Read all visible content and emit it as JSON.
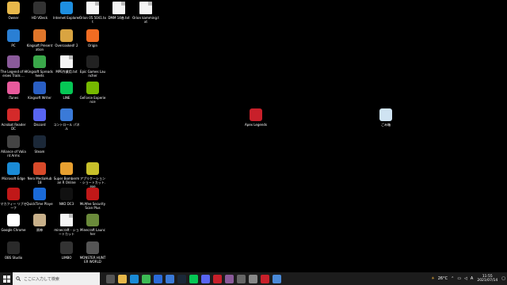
{
  "desktop_icons": [
    {
      "label": "Owner",
      "icon": "user-folder-icon",
      "color": "#e8b84a"
    },
    {
      "label": "HD VDeck",
      "icon": "hd-vdeck-icon",
      "color": "#333333"
    },
    {
      "label": "Internet Explorer",
      "icon": "internet-explorer-icon",
      "color": "#1e8fe0"
    },
    {
      "label": "Orion 05.5041.txt",
      "icon": "text-file-icon",
      "color": "#f4f4f4"
    },
    {
      "label": "DMM 14巻.txt",
      "icon": "text-file-icon",
      "color": "#f4f4f4"
    },
    {
      "label": "Orion kamming.txt",
      "icon": "text-file-icon",
      "color": "#f4f4f4"
    },
    {
      "label": "PC",
      "icon": "pc-icon",
      "color": "#2a7fd4"
    },
    {
      "label": "Kingsoft Presentation",
      "icon": "kingsoft-presentation-icon",
      "color": "#e0762a"
    },
    {
      "label": "Overcooked! 2",
      "icon": "overcooked-icon",
      "color": "#d9a441"
    },
    {
      "label": "Origin",
      "icon": "origin-icon",
      "color": "#f26c22"
    },
    {
      "label": "The Legend of Heroes Trails ...",
      "icon": "game-icon",
      "color": "#8a5a9a"
    },
    {
      "label": "Kingsoft Spreadsheets",
      "icon": "kingsoft-spreadsheets-icon",
      "color": "#3aa84a"
    },
    {
      "label": "MPE作業用.txt",
      "icon": "text-file-icon",
      "color": "#f4f4f4"
    },
    {
      "label": "Epic Games Launcher",
      "icon": "epic-games-icon",
      "color": "#222222"
    },
    {
      "label": "iTunes",
      "icon": "itunes-icon",
      "color": "#e85a9c"
    },
    {
      "label": "Kingsoft Writer",
      "icon": "kingsoft-writer-icon",
      "color": "#2a5fc4"
    },
    {
      "label": "LINE",
      "icon": "line-icon",
      "color": "#06c755"
    },
    {
      "label": "GeForce Experience",
      "icon": "geforce-icon",
      "color": "#76b900"
    },
    {
      "label": "Acrobat Reader DC",
      "icon": "acrobat-icon",
      "color": "#d42a2a"
    },
    {
      "label": "Discord",
      "icon": "discord-icon",
      "color": "#5865f2"
    },
    {
      "label": "コントロール パネル",
      "icon": "control-panel-icon",
      "color": "#3a7ad8"
    },
    {
      "label": "Apex Legends",
      "icon": "apex-legends-icon",
      "color": "#c8202a"
    },
    {
      "label": "ごみ箱",
      "icon": "recycle-bin-icon",
      "color": "#cfe3f2"
    },
    {
      "label": "Alliance of Valiant Arms",
      "icon": "ava-icon",
      "color": "#444444"
    },
    {
      "label": "Steam",
      "icon": "steam-icon",
      "color": "#1b2838"
    },
    {
      "label": "Microsoft Edge",
      "icon": "edge-icon",
      "color": "#1a8bd6"
    },
    {
      "label": "Nero MediaHub 18",
      "icon": "nero-icon",
      "color": "#d84a2a"
    },
    {
      "label": "Super Bomberman R Online",
      "icon": "bomberman-icon",
      "color": "#e8a030"
    },
    {
      "label": "アプリケーション - ショートカット.exe",
      "icon": "app-shortcut-icon",
      "color": "#c8c02a"
    },
    {
      "label": "マカフィー リブセーフ",
      "icon": "mcafee-icon",
      "color": "#c01818"
    },
    {
      "label": "QuickTime Player",
      "icon": "quicktime-icon",
      "color": "#1a6ad8"
    },
    {
      "label": "NKO DC3",
      "icon": "nko-icon",
      "color": "#111111"
    },
    {
      "label": "McAfee Security Scan Plus",
      "icon": "mcafee-scan-icon",
      "color": "#c01818"
    },
    {
      "label": "Google Chrome",
      "icon": "chrome-icon",
      "color": "#ffffff"
    },
    {
      "label": "原神",
      "icon": "genshin-icon",
      "color": "#c8b08a"
    },
    {
      "label": "minecraft - ショートカット",
      "icon": "text-file-icon",
      "color": "#f4f4f4"
    },
    {
      "label": "Minecraft Launcher",
      "icon": "minecraft-icon",
      "color": "#6a8a3a"
    },
    {
      "label": "OBS Studio",
      "icon": "obs-icon",
      "color": "#2a2a2a"
    },
    {
      "label": "LIMBO",
      "icon": "limbo-icon",
      "color": "#333333"
    },
    {
      "label": "MONSTER HUNTER WORLD",
      "icon": "monster-hunter-icon",
      "color": "#555555"
    }
  ],
  "taskbar": {
    "search_placeholder": "ここに入力して検索",
    "temperature": "26°C",
    "ime": "A",
    "time": "11:55",
    "date": "2021/07/14",
    "pinned": [
      {
        "name": "task-view-icon",
        "color": "#555555"
      },
      {
        "name": "file-explorer-icon",
        "color": "#e8b84a"
      },
      {
        "name": "edge-taskbar-icon",
        "color": "#1a8bd6"
      },
      {
        "name": "chrome-taskbar-icon",
        "color": "#3cba54"
      },
      {
        "name": "mail-icon",
        "color": "#2a6ad8"
      },
      {
        "name": "store-icon",
        "color": "#3a7ad8"
      },
      {
        "name": "steam-taskbar-icon",
        "color": "#1b2838"
      },
      {
        "name": "line-taskbar-icon",
        "color": "#06c755"
      },
      {
        "name": "discord-taskbar-icon",
        "color": "#5865f2"
      },
      {
        "name": "app-taskbar-icon",
        "color": "#c8202a"
      },
      {
        "name": "game-taskbar-icon",
        "color": "#8a5a9a"
      },
      {
        "name": "obs-taskbar-icon",
        "color": "#666666"
      },
      {
        "name": "gear-taskbar-icon",
        "color": "#888888"
      },
      {
        "name": "apex-taskbar-icon",
        "color": "#c8202a"
      },
      {
        "name": "photos-taskbar-icon",
        "color": "#4a8ad8"
      }
    ]
  }
}
